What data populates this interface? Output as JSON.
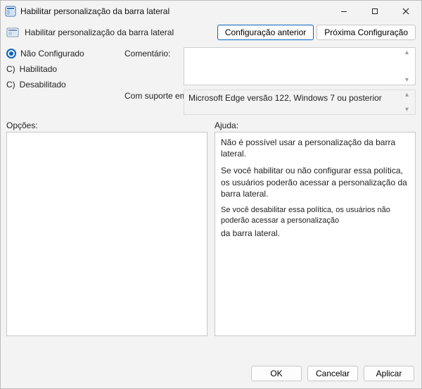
{
  "window": {
    "title": "Habilitar personalização da barra lateral"
  },
  "header": {
    "title": "Habilitar personalização da barra lateral",
    "prev_btn": "Configuração anterior",
    "next_btn": "Próxima Configuração"
  },
  "radios": {
    "not_configured": "Não Configurado",
    "enabled": "Habilitado",
    "disabled": "Desabilitado",
    "enabled_prefix": "C)",
    "disabled_prefix": "C)",
    "selected": "not_configured"
  },
  "fields": {
    "comment_label": "Comentário:",
    "comment_value": "",
    "supported_label": "Com suporte em:",
    "supported_value": "Microsoft Edge versão 122, Windows 7 ou posterior"
  },
  "panels": {
    "options_label": "Opções:",
    "help_label": "Ajuda:"
  },
  "help": {
    "p1": "Não é possível usar a personalização da barra lateral.",
    "p2": "Se você habilitar ou não configurar essa política, os usuários poderão acessar a personalização da barra lateral.",
    "p3": "Se você desabilitar essa política, os usuários não poderão acessar a personalização",
    "p4": "da barra lateral."
  },
  "footer": {
    "ok": "OK",
    "cancel": "Cancelar",
    "apply": "Aplicar"
  }
}
